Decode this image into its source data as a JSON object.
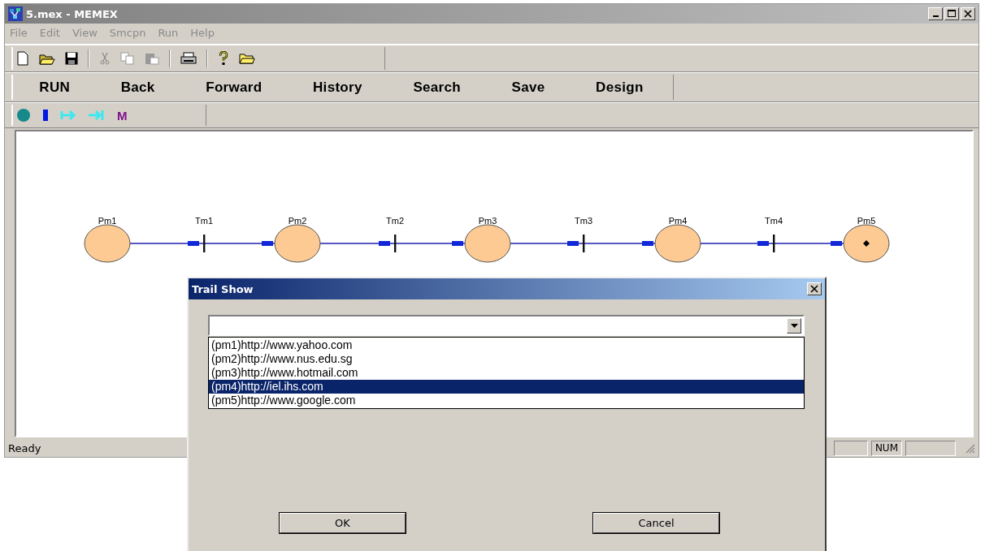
{
  "window": {
    "title": "5.mex - MEMEX"
  },
  "menu": [
    {
      "label": "File",
      "disabled": true
    },
    {
      "label": "Edit",
      "disabled": true
    },
    {
      "label": "View",
      "disabled": true
    },
    {
      "label": "Smcpn",
      "disabled": true
    },
    {
      "label": "Run",
      "disabled": true
    },
    {
      "label": "Help",
      "disabled": true
    }
  ],
  "nav_buttons": [
    "RUN",
    "Back",
    "Forward",
    "History",
    "Search",
    "Save",
    "Design"
  ],
  "palette": [
    {
      "kind": "place"
    },
    {
      "kind": "transition"
    },
    {
      "kind": "arc"
    },
    {
      "kind": "inhibitor"
    },
    {
      "kind": "text",
      "label": "M"
    }
  ],
  "net": {
    "places": [
      {
        "label": "Pm1",
        "marked": false
      },
      {
        "label": "Pm2",
        "marked": false
      },
      {
        "label": "Pm3",
        "marked": false
      },
      {
        "label": "Pm4",
        "marked": false
      },
      {
        "label": "Pm5",
        "marked": true
      }
    ],
    "transitions": [
      {
        "label": "Tm1"
      },
      {
        "label": "Tm2"
      },
      {
        "label": "Tm3"
      },
      {
        "label": "Tm4"
      }
    ]
  },
  "status_bar": {
    "text": "Ready",
    "indicators": [
      "NUM"
    ]
  },
  "dialog": {
    "title": "Trail Show",
    "items": [
      {
        "label": "(pm1)http://www.yahoo.com",
        "selected": false
      },
      {
        "label": "(pm2)http://www.nus.edu.sg",
        "selected": false
      },
      {
        "label": "(pm3)http://www.hotmail.com",
        "selected": false
      },
      {
        "label": "(pm4)http://iel.ihs.com",
        "selected": true
      },
      {
        "label": "(pm5)http://www.google.com",
        "selected": false
      }
    ],
    "buttons": [
      "OK",
      "Cancel"
    ]
  }
}
